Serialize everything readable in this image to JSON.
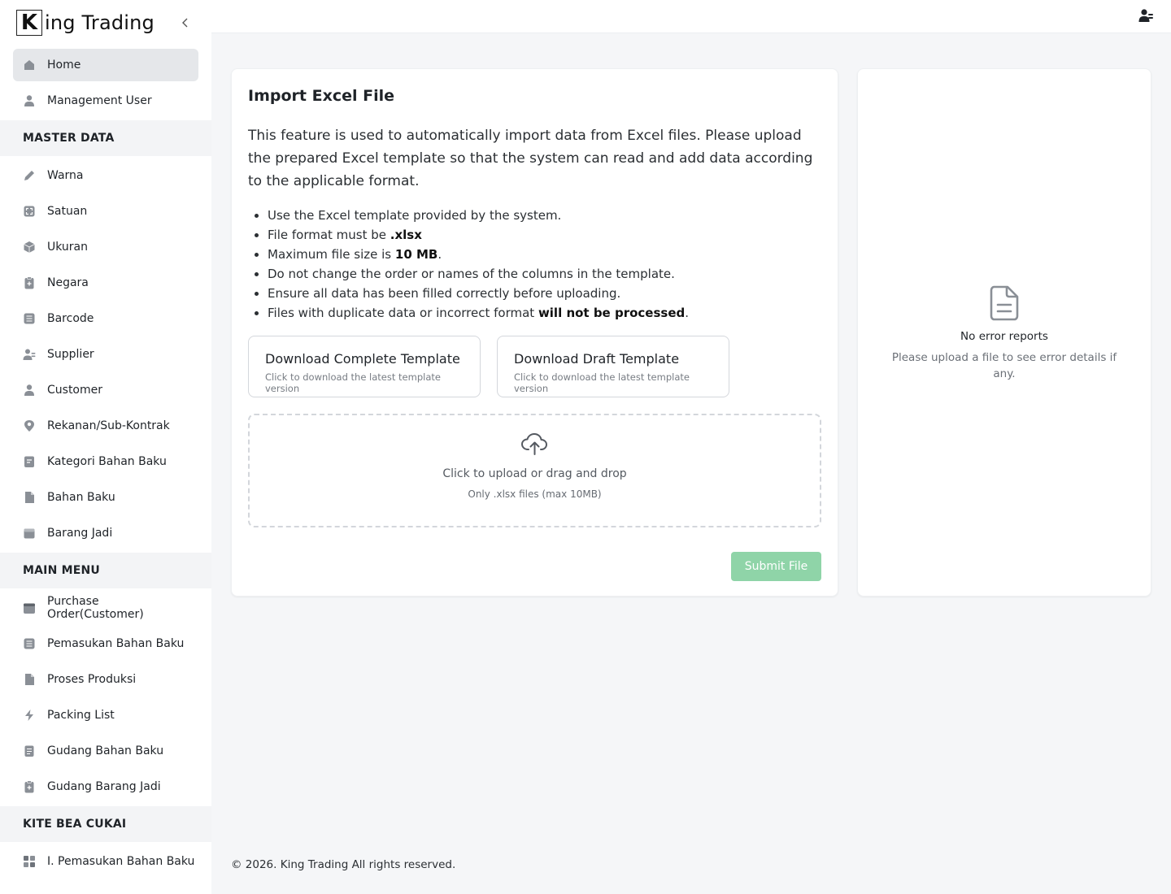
{
  "brand": {
    "logo_letter": "K",
    "name": "ing Trading"
  },
  "sidebar": {
    "top_items": [
      {
        "label": "Home",
        "icon": "home-icon",
        "active": true
      },
      {
        "label": "Management User",
        "icon": "user-icon"
      }
    ],
    "sections": [
      {
        "title": "MASTER DATA",
        "items": [
          {
            "label": "Warna",
            "icon": "pen-icon"
          },
          {
            "label": "Satuan",
            "icon": "expand-box-icon"
          },
          {
            "label": "Ukuran",
            "icon": "cube-icon"
          },
          {
            "label": "Negara",
            "icon": "clipboard-plus-icon"
          },
          {
            "label": "Barcode",
            "icon": "list-box-icon"
          },
          {
            "label": "Supplier",
            "icon": "users-icon"
          },
          {
            "label": "Customer",
            "icon": "user-icon"
          },
          {
            "label": "Rekanan/Sub-Kontrak",
            "icon": "map-pin-icon"
          },
          {
            "label": "Kategori Bahan Baku",
            "icon": "note-icon"
          },
          {
            "label": "Bahan Baku",
            "icon": "document-icon"
          },
          {
            "label": "Barang Jadi",
            "icon": "box-icon"
          }
        ]
      },
      {
        "title": "MAIN MENU",
        "items": [
          {
            "label": "Purchase Order(Customer)",
            "icon": "calendar-icon"
          },
          {
            "label": "Pemasukan Bahan Baku",
            "icon": "list-box-icon"
          },
          {
            "label": "Proses Produksi",
            "icon": "document-icon"
          },
          {
            "label": "Packing List",
            "icon": "bolt-icon"
          },
          {
            "label": "Gudang Bahan Baku",
            "icon": "file-lines-icon"
          },
          {
            "label": "Gudang Barang Jadi",
            "icon": "clipboard-plus-icon"
          }
        ]
      },
      {
        "title": "KITE BEA CUKAI",
        "items": [
          {
            "label": "I. Pemasukan Bahan Baku",
            "icon": "grid-icon"
          }
        ]
      }
    ]
  },
  "import": {
    "title": "Import Excel File",
    "description": "This feature is used to automatically import data from Excel files. Please upload the prepared Excel template so that the system can read and add data according to the applicable format.",
    "rules": [
      {
        "text": "Use the Excel template provided by the system.",
        "bold": "",
        "after": ""
      },
      {
        "text": "File format must be ",
        "bold": ".xlsx",
        "after": ""
      },
      {
        "text": "Maximum file size is ",
        "bold": "10 MB",
        "after": "."
      },
      {
        "text": "Do not change the order or names of the columns in the template.",
        "bold": "",
        "after": ""
      },
      {
        "text": "Ensure all data has been filled correctly before uploading.",
        "bold": "",
        "after": ""
      },
      {
        "text": "Files with duplicate data or incorrect format ",
        "bold": "will not be processed",
        "after": "."
      }
    ],
    "download_complete": {
      "title": "Download Complete Template",
      "subtitle": "Click to download the latest template version"
    },
    "download_draft": {
      "title": "Download Draft Template",
      "subtitle": "Click to download the latest template version"
    },
    "dropzone": {
      "text": "Click to upload or drag and drop",
      "hint": "Only .xlsx files (max 10MB)"
    },
    "submit_label": "Submit File"
  },
  "errors": {
    "title": "No error reports",
    "subtitle": "Please upload a file to see error details if any."
  },
  "footer": "© 2026. King Trading All rights reserved.",
  "colors": {
    "submit_bg": "#8fd4a8",
    "active_nav_bg": "#e5e7ea",
    "icon_gray": "#8a8f96"
  }
}
